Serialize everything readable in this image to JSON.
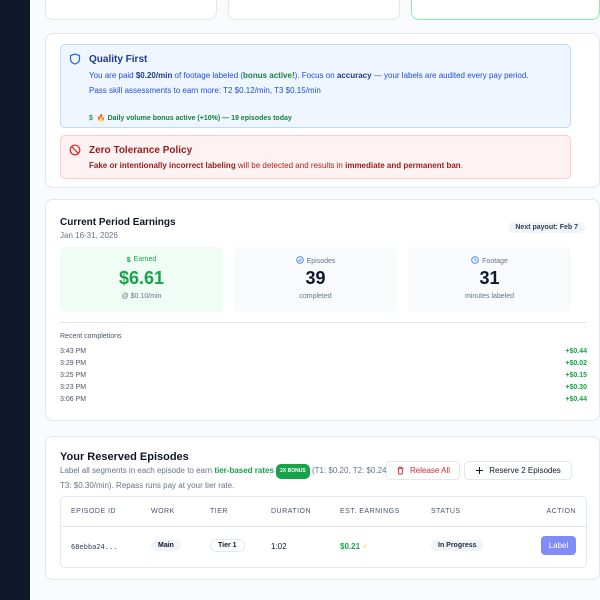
{
  "quality": {
    "title": "Quality First",
    "line1_a": "You are paid ",
    "line1_rate": "$0.20/min",
    "line1_b": " of footage labeled (",
    "line1_bonus": "bonus active!",
    "line1_c": "). Focus on ",
    "line1_acc": "accuracy",
    "line1_d": " — your labels are audited every pay period.",
    "line2": "Pass skill assessments to earn more: T2 $0.12/min, T3 $0.15/min",
    "daily_icon": "$",
    "daily": "🔥 Daily volume bonus active (+10%) — 19 episodes today"
  },
  "policy": {
    "title": "Zero Tolerance Policy",
    "text_a": "Fake or intentionally incorrect labeling",
    "text_b": " will be detected and results in ",
    "text_c": "immediate and permanent ban",
    "text_d": "."
  },
  "earnings": {
    "title": "Current Period Earnings",
    "period": "Jan 16-31, 2026",
    "payout": "Next payout: Feb 7",
    "stats": [
      {
        "label": "Earned",
        "value": "$6.61",
        "note": "@ $0.10/min",
        "icon": "dollar-icon"
      },
      {
        "label": "Episodes",
        "value": "39",
        "note": "completed",
        "icon": "check-circle-icon"
      },
      {
        "label": "Footage",
        "value": "31",
        "note": "minutes labeled",
        "icon": "clock-icon"
      }
    ],
    "recent_title": "Recent completions",
    "recent": [
      {
        "time": "3:43 PM",
        "amount": "+$0.44"
      },
      {
        "time": "3:29 PM",
        "amount": "+$0.02"
      },
      {
        "time": "3:25 PM",
        "amount": "+$0.15"
      },
      {
        "time": "3:23 PM",
        "amount": "+$0.30"
      },
      {
        "time": "3:06 PM",
        "amount": "+$0.44"
      }
    ]
  },
  "reserved": {
    "title": "Your Reserved Episodes",
    "desc_a": "Label all segments in each episode to earn ",
    "desc_tier": "tier-based rates",
    "desc_bonus": "2X BONUS",
    "desc_b": " (T1: $0.20, T2: $0.24, T3: $0.30/min).  Repass runs pay at your tier rate.",
    "release_label": "Release All",
    "reserve_label": "Reserve 2 Episodes",
    "columns": [
      "EPISODE ID",
      "WORK",
      "TIER",
      "DURATION",
      "EST. EARNINGS",
      "STATUS",
      "ACTION"
    ],
    "row": {
      "id": "68ebba24...",
      "work": "Main",
      "tier": "Tier 1",
      "duration": "1:02",
      "earnings": "$0.21",
      "bolt": "⚡",
      "status": "In Progress",
      "action": "Label"
    }
  },
  "colors": {
    "accent": "#16a34a",
    "info": "#1d4ed8",
    "danger": "#dc2626",
    "primary_button": "#818cf8"
  }
}
